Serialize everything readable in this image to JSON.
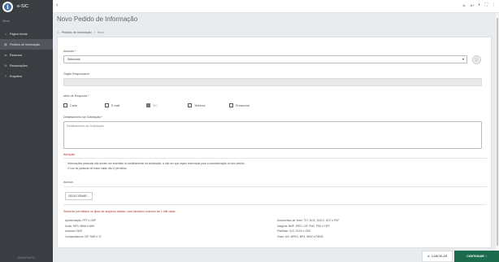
{
  "sidebar": {
    "brand": "e-SIC",
    "menu_title": "Menu",
    "items": [
      {
        "label": "Página Inicial",
        "icon": "home-icon",
        "glyph": "⌂"
      },
      {
        "label": "Pedidos de Informação",
        "icon": "file-icon",
        "glyph": "▤"
      },
      {
        "label": "Recursos",
        "icon": "gavel-icon",
        "glyph": "⚖"
      },
      {
        "label": "Reclamações",
        "icon": "chat-icon",
        "glyph": "✉"
      },
      {
        "label": "Enquetes",
        "icon": "question-icon",
        "glyph": "?"
      }
    ],
    "footer": "SMARAPD"
  },
  "topbar": {
    "back_icon": "back-arrow-icon",
    "font_smaller": "A-",
    "font_larger": "A+",
    "contrast_glyph": "◐",
    "fullscreen_glyph": "⛶",
    "menu_glyph": "⋮"
  },
  "page": {
    "title": "Novo Pedido de Informação",
    "breadcrumb": [
      "Pedidos de Informação",
      "Novo"
    ]
  },
  "form": {
    "assunto_label": "Assunto",
    "assunto_value": "Selecione",
    "orgao_label": "Órgão Responsável",
    "meio_label": "Meio de Resposta",
    "meio_options": [
      {
        "label": "Carta",
        "disabled": false
      },
      {
        "label": "E-mail",
        "disabled": false
      },
      {
        "label": "SIC",
        "disabled": true
      },
      {
        "label": "Telefone",
        "disabled": false
      },
      {
        "label": "Presencial",
        "disabled": false
      }
    ],
    "detalhamento_label": "Detalhamento da Solicitação",
    "detalhamento_placeholder": "Detalhamento da Solicitação",
    "required_mark": "*"
  },
  "atencao": {
    "title": "Atenção",
    "line1": "Informações pessoais não devem ser inseridas no detalhamento da solicitação, a não ser que sejam essenciais para a caracterização do seu pedido.",
    "line2": "O uso de palavras de baixo calão não é permitido."
  },
  "anexos": {
    "title": "Anexos",
    "select_button": "SELECIONAR..."
  },
  "formats": {
    "title": "Somente permitidos os tipos de arquivos abaixo, com tamanho máximo de 1 MB cada:",
    "left": [
      "Apresentação: PPT e ODP",
      "Áudio: MP3, WMA e WAV",
      "Autocad: DWG",
      "Compactadores: ZIP, RAR e 7Z"
    ],
    "right": [
      "Documentos de Texto: TXT, DOC, DOCX, ODT e PDF",
      "Imagens: BMP, JPEG, GIF, PNG, PSD e TIFF",
      "Planilhas: XLS, XLSX e ODS",
      "Vídeo: AVI, MPEG, MP4, WMV e RMVB"
    ]
  },
  "actions": {
    "cancel": "CANCELAR",
    "continue": "CONTINUAR"
  }
}
